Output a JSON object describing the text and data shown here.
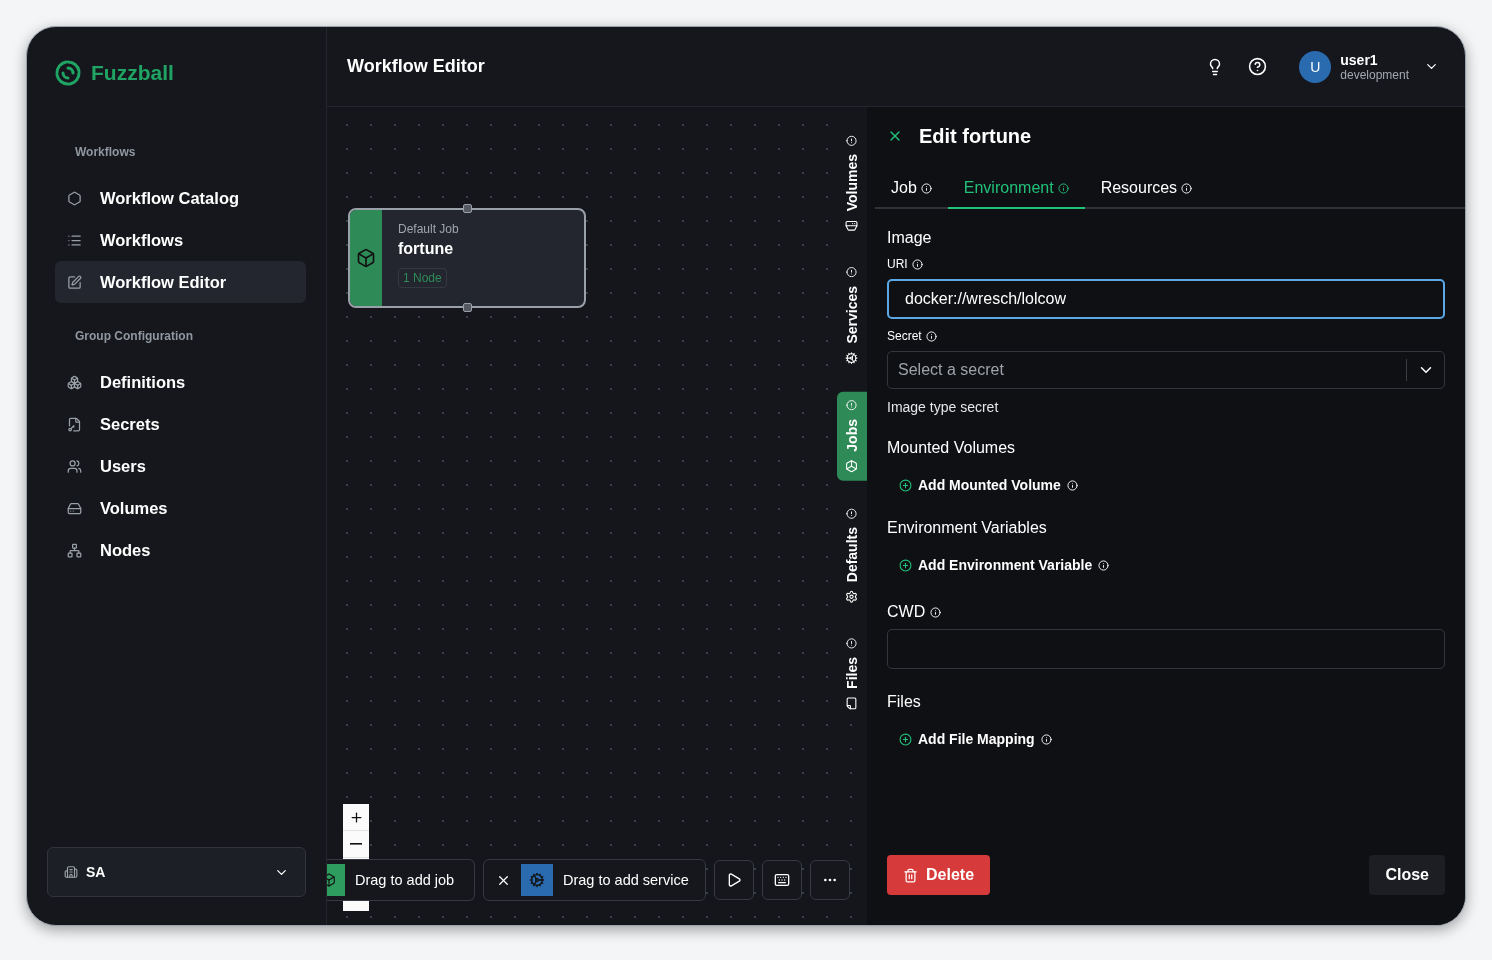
{
  "app": {
    "name": "Fuzzball"
  },
  "sidebar": {
    "sections": [
      {
        "heading": "Workflows",
        "items": [
          {
            "label": "Workflow Catalog",
            "selected": false
          },
          {
            "label": "Workflows",
            "selected": false
          },
          {
            "label": "Workflow Editor",
            "selected": true
          }
        ]
      },
      {
        "heading": "Group Configuration",
        "items": [
          {
            "label": "Definitions",
            "selected": false
          },
          {
            "label": "Secrets",
            "selected": false
          },
          {
            "label": "Users",
            "selected": false
          },
          {
            "label": "Volumes",
            "selected": false
          },
          {
            "label": "Nodes",
            "selected": false
          }
        ]
      }
    ],
    "org": {
      "label": "SA"
    }
  },
  "header": {
    "title": "Workflow Editor",
    "user": {
      "initial": "U",
      "name": "user1",
      "role": "development"
    }
  },
  "canvas": {
    "nodes": [
      {
        "kind": "job",
        "category": "Default Job",
        "name": "fortune",
        "badge": "1 Node"
      }
    ],
    "toolbar": {
      "job_chip": "Drag to add job",
      "service_chip": "Drag to add service"
    }
  },
  "side_tabs": [
    {
      "label": "Volumes",
      "selected": false
    },
    {
      "label": "Services",
      "selected": false
    },
    {
      "label": "Jobs",
      "selected": true
    },
    {
      "label": "Defaults",
      "selected": false
    },
    {
      "label": "Files",
      "selected": false
    }
  ],
  "panel": {
    "title": "Edit fortune",
    "tabs": [
      {
        "label": "Job",
        "selected": false
      },
      {
        "label": "Environment",
        "selected": true
      },
      {
        "label": "Resources",
        "selected": false
      }
    ],
    "image": {
      "heading": "Image",
      "uri_label": "URI",
      "uri_value": "docker://wresch/lolcow",
      "secret_label": "Secret",
      "secret_placeholder": "Select a secret",
      "secret_hint": "Image type secret"
    },
    "mounted_volumes": {
      "heading": "Mounted Volumes",
      "add": "Add Mounted Volume"
    },
    "environment_variables": {
      "heading": "Environment Variables",
      "add": "Add Environment Variable"
    },
    "cwd": {
      "heading": "CWD"
    },
    "files": {
      "heading": "Files",
      "add": "Add File Mapping"
    },
    "delete": "Delete",
    "close": "Close"
  }
}
